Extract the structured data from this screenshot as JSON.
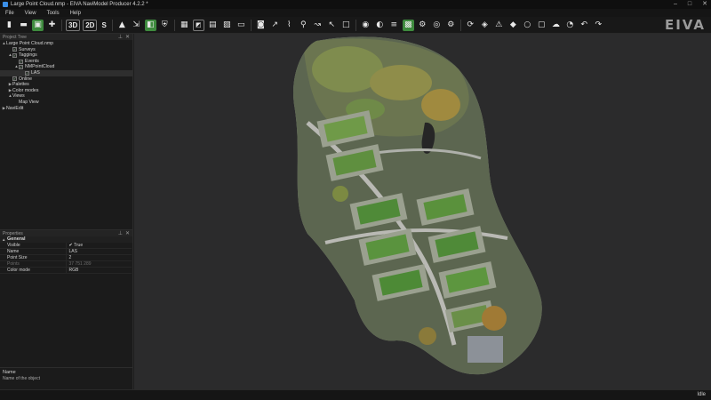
{
  "window": {
    "title": "Large Point Cloud.nmp - EIVA NaviModel Producer 4.2.2 *"
  },
  "menu": [
    "File",
    "View",
    "Tools",
    "Help"
  ],
  "toolbar": {
    "view_3d": "3D",
    "view_2d": "2D",
    "view_s": "S",
    "logo": "EIVA"
  },
  "project_tree": {
    "title": "Project Tree",
    "items": [
      {
        "label": "Large Point Cloud.nmp",
        "level": 0,
        "arrow": "▲",
        "check": false
      },
      {
        "label": "Surveys",
        "level": 1,
        "arrow": "",
        "check": true
      },
      {
        "label": "Taggings",
        "level": 1,
        "arrow": "▲",
        "check": true
      },
      {
        "label": "Events",
        "level": 2,
        "arrow": "",
        "check": true
      },
      {
        "label": "NMPointCloud",
        "level": 2,
        "arrow": "▲",
        "check": true
      },
      {
        "label": "LAS",
        "level": 3,
        "arrow": "",
        "check": true,
        "selected": true
      },
      {
        "label": "Online",
        "level": 1,
        "arrow": "",
        "check": true
      },
      {
        "label": "Palettes",
        "level": 1,
        "arrow": "▶",
        "check": false
      },
      {
        "label": "Color modes",
        "level": 1,
        "arrow": "▶",
        "check": false
      },
      {
        "label": "Views",
        "level": 1,
        "arrow": "▲",
        "check": false
      },
      {
        "label": "Map View",
        "level": 2,
        "arrow": "",
        "check": false
      },
      {
        "label": "NaviEdit",
        "level": 0,
        "arrow": "▶",
        "check": false
      }
    ]
  },
  "properties": {
    "title": "Properties",
    "group": "General",
    "rows": [
      {
        "name": "Visible",
        "value": "True",
        "check": true,
        "dim": false
      },
      {
        "name": "Name",
        "value": "LAS",
        "check": false,
        "dim": false
      },
      {
        "name": "Point Size",
        "value": "2",
        "check": false,
        "dim": false
      },
      {
        "name": "Points",
        "value": "37 751 289",
        "check": false,
        "dim": true
      },
      {
        "name": "Color mode",
        "value": "RGB",
        "check": false,
        "dim": false
      }
    ],
    "description": {
      "name": "Name",
      "text": "Name of the object"
    }
  },
  "status": {
    "text": "Idle"
  },
  "colors": {
    "background": "#1e1e1e",
    "viewport": "#2b2b2c",
    "accent_green": "#3e8a3e"
  }
}
